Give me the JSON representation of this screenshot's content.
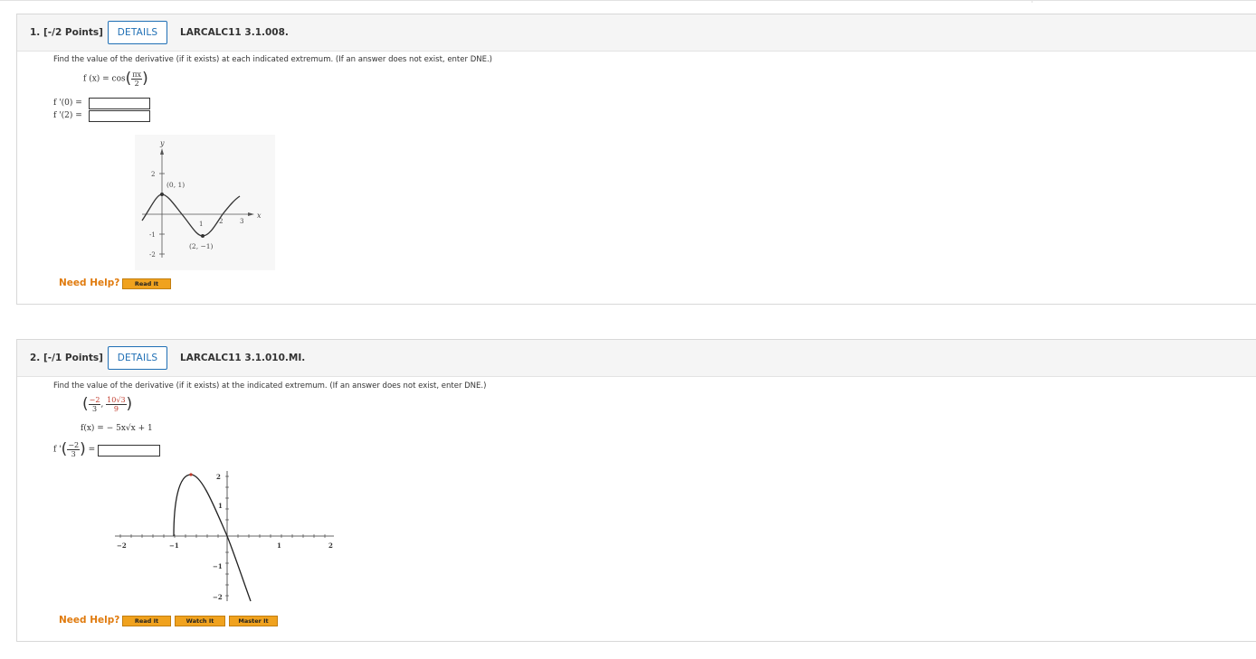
{
  "questions": [
    {
      "number": "1. [-/2 Points]",
      "details_label": "DETAILS",
      "code": "LARCALC11 3.1.008.",
      "prompt": "Find the value of the derivative (if it exists) at each indicated extremum. (If an answer does not exist, enter DNE.)",
      "function": {
        "lhs": "f (x) = cos",
        "frac_num": "πx",
        "frac_den": "2"
      },
      "answers": [
        {
          "label": "f '(0) =",
          "value": ""
        },
        {
          "label": "f '(2) =",
          "value": ""
        }
      ],
      "graph": {
        "axis_x": "x",
        "axis_y": "y",
        "y_ticks": [
          "2",
          "-1",
          "-2"
        ],
        "x_ticks": [
          "1",
          "2",
          "3"
        ],
        "point_labels": [
          "(0, 1)",
          "(2, −1)"
        ]
      },
      "help_label": "Need Help?",
      "help_buttons": [
        "Read It"
      ]
    },
    {
      "number": "2. [-/1 Points]",
      "details_label": "DETAILS",
      "code": "LARCALC11 3.1.010.MI.",
      "prompt": "Find the value of the derivative (if it exists) at the indicated extremum. (If an answer does not exist, enter DNE.)",
      "point": {
        "x_num": "−2",
        "x_den": "3",
        "y_num": "10√3",
        "y_den": "9"
      },
      "function": "f(x) = − 5x√x + 1",
      "answer": {
        "label_prefix": "f '",
        "arg_num": "−2",
        "arg_den": "3",
        "eq": "=",
        "value": ""
      },
      "graph": {
        "x_ticks": [
          "−2",
          "−1",
          "1",
          "2"
        ],
        "y_ticks": [
          "2",
          "1",
          "−1",
          "−2"
        ]
      },
      "help_label": "Need Help?",
      "help_buttons": [
        "Read It",
        "Watch It",
        "Master It"
      ]
    }
  ]
}
